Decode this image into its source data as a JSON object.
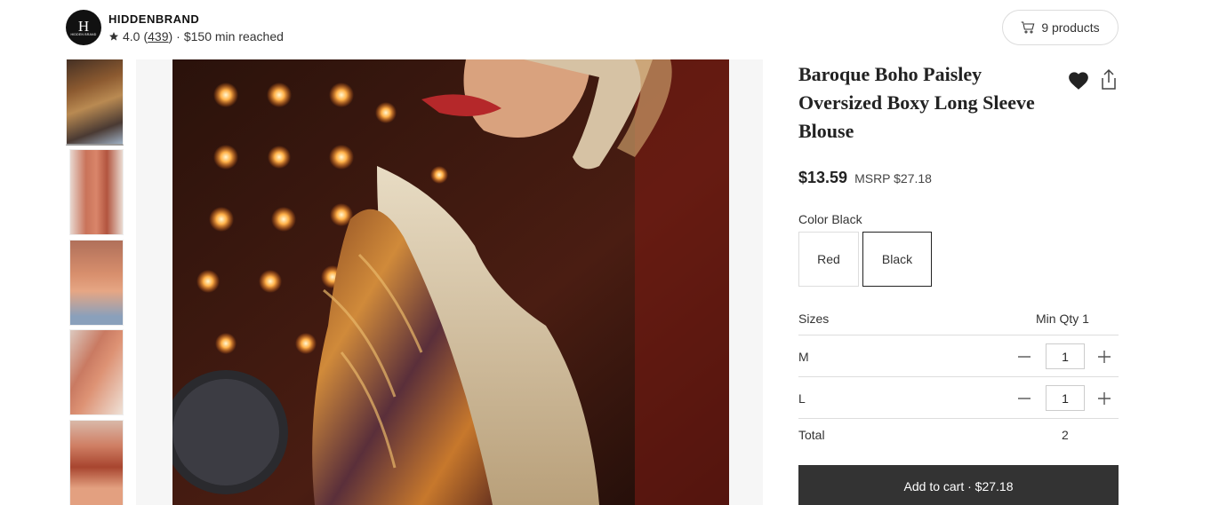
{
  "shop": {
    "logo_letter": "H",
    "logo_subtext": "HIDDEN BRAND",
    "name": "HIDDENBRAND",
    "rating": "4.0",
    "review_count": "439",
    "min_order": "$150 min reached"
  },
  "header": {
    "products_button": "9 products"
  },
  "gallery": {
    "thumbnails": [
      "thumb-1",
      "thumb-2",
      "thumb-3",
      "thumb-4",
      "thumb-5"
    ]
  },
  "product": {
    "title": "Baroque Boho Paisley Oversized Boxy Long Sleeve Blouse",
    "price": "$13.59",
    "msrp": "MSRP $27.18",
    "color_label": "Color Black",
    "colors": [
      "Red",
      "Black"
    ],
    "selected_color": "Black",
    "sizes_label": "Sizes",
    "min_qty_label": "Min Qty 1",
    "sizes": [
      {
        "size": "M",
        "qty": "1"
      },
      {
        "size": "L",
        "qty": "1"
      }
    ],
    "total_label": "Total",
    "total_value": "2",
    "add_to_cart": "Add to cart · $27.18"
  },
  "icons": {
    "star": "star-icon",
    "cart": "cart-icon",
    "heart": "heart-icon",
    "share": "share-icon",
    "minus": "minus-icon",
    "plus": "plus-icon"
  },
  "colors": {
    "primary_button": "#333333",
    "border": "#dddddd",
    "text": "#222222"
  }
}
